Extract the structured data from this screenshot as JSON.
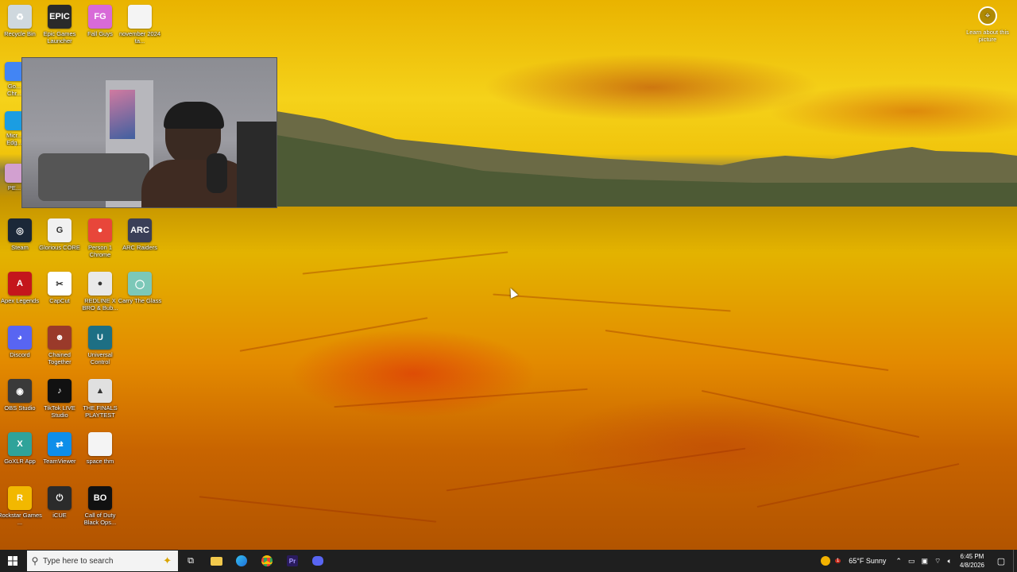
{
  "desktop": {
    "icons": [
      {
        "name": "recycle-bin-icon",
        "label": "Recycle Bin",
        "bg": "#cfd8de",
        "glyph": "♻"
      },
      {
        "name": "epic-games-launcher-icon",
        "label": "Epic Games Launcher",
        "bg": "#2a2a2a",
        "glyph": "EPIC"
      },
      {
        "name": "fall-guys-icon",
        "label": "Fall Guys",
        "bg": "#d86ad8",
        "glyph": "FG"
      },
      {
        "name": "text-file-icon",
        "label": "november 2024 ta...",
        "bg": "#f4f4f4",
        "glyph": ""
      },
      {
        "name": "steam-icon",
        "label": "Steam",
        "bg": "#1b2838",
        "glyph": "◎"
      },
      {
        "name": "glorious-core-icon",
        "label": "Glorious CORE",
        "bg": "#f1f1f1",
        "glyph": "G"
      },
      {
        "name": "chrome-person-icon",
        "label": "Person 1 Chrome",
        "bg": "#e8463a",
        "glyph": "●"
      },
      {
        "name": "arc-raiders-icon",
        "label": "ARC Raiders",
        "bg": "#3a3f58",
        "glyph": "ARC"
      },
      {
        "name": "apex-legends-icon",
        "label": "Apex Legends",
        "bg": "#c4161c",
        "glyph": "A"
      },
      {
        "name": "capcut-icon",
        "label": "CapCut",
        "bg": "#ffffff",
        "glyph": "✂"
      },
      {
        "name": "redline-icon",
        "label": "REDLINE X BRO & Bub...",
        "bg": "#e9e9e9",
        "glyph": "●"
      },
      {
        "name": "carry-the-glass-icon",
        "label": "Carry The Glass",
        "bg": "#7cc8b8",
        "glyph": "◯"
      },
      {
        "name": "discord-icon",
        "label": "Discord",
        "bg": "#5865f2",
        "glyph": "◕"
      },
      {
        "name": "chained-together-icon",
        "label": "Chained Together",
        "bg": "#9a3a2a",
        "glyph": "☻"
      },
      {
        "name": "universal-control-icon",
        "label": "Universal Control",
        "bg": "#1d6f84",
        "glyph": "U"
      },
      {
        "name": "obs-studio-icon",
        "label": "OBS Studio",
        "bg": "#3a3a3a",
        "glyph": "◉"
      },
      {
        "name": "tiktok-live-studio-icon",
        "label": "TikTok LIVE Studio",
        "bg": "#111111",
        "glyph": "♪"
      },
      {
        "name": "the-finals-icon",
        "label": "THE FINALS PLAYTEST",
        "bg": "#e0e0e0",
        "glyph": "▲"
      },
      {
        "name": "goxlr-app-icon",
        "label": "GoXLR App",
        "bg": "#2fa39a",
        "glyph": "X"
      },
      {
        "name": "teamviewer-icon",
        "label": "TeamViewer",
        "bg": "#0e8ee9",
        "glyph": "⇄"
      },
      {
        "name": "space-file-icon",
        "label": "space thm",
        "bg": "#f4f4f4",
        "glyph": ""
      },
      {
        "name": "rockstar-games-icon",
        "label": "Rockstar Games ...",
        "bg": "#f2b800",
        "glyph": "R"
      },
      {
        "name": "icue-icon",
        "label": "iCUE",
        "bg": "#2b2b2b",
        "glyph": "⏻"
      },
      {
        "name": "call-of-duty-icon",
        "label": "Call of Duty Black Ops...",
        "bg": "#111111",
        "glyph": "BO"
      }
    ],
    "partial_icons": [
      {
        "name": "chrome-icon-partial",
        "label": "Go... Chr...",
        "bg": "#4285f4"
      },
      {
        "name": "microsoft-edge-icon-partial",
        "label": "Micr... Edg...",
        "bg": "#1b9de2"
      },
      {
        "name": "pe-icon-partial",
        "label": "PE...",
        "bg": "#d2a0d0"
      }
    ],
    "learn_about_picture": "Learn about this picture"
  },
  "taskbar": {
    "search_placeholder": "Type here to search",
    "weather": "65°F  Sunny",
    "notification_count": "1",
    "time": "6:45 PM",
    "date": "4/8/2026"
  }
}
